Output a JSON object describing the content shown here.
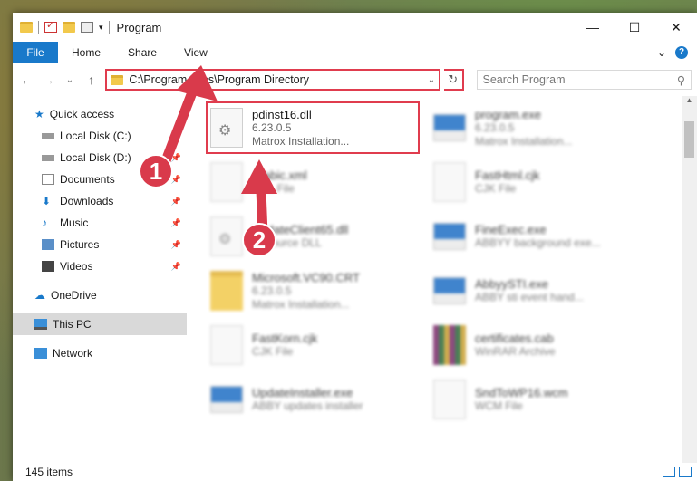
{
  "window": {
    "title": "Program",
    "minimize": "—",
    "maximize": "☐",
    "close": "✕"
  },
  "ribbon": {
    "file": "File",
    "home": "Home",
    "share": "Share",
    "view": "View",
    "expand": "⌄",
    "help": "?"
  },
  "nav": {
    "back": "←",
    "forward": "→",
    "recent": "⌄",
    "up": "↑",
    "refresh": "↻",
    "address": "C:\\Program Files\\Program Directory",
    "search_placeholder": "Search Program",
    "search_icon": "⚲"
  },
  "sidebar": {
    "quick_access": "Quick access",
    "items": [
      {
        "label": "Local Disk (C:)",
        "icon": "drive-icon"
      },
      {
        "label": "Local Disk (D:)",
        "icon": "drive-icon"
      },
      {
        "label": "Documents",
        "icon": "documents-icon"
      },
      {
        "label": "Downloads",
        "icon": "downloads-icon"
      },
      {
        "label": "Music",
        "icon": "music-icon"
      },
      {
        "label": "Pictures",
        "icon": "pictures-icon"
      },
      {
        "label": "Videos",
        "icon": "videos-icon"
      }
    ],
    "onedrive": "OneDrive",
    "this_pc": "This PC",
    "network": "Network"
  },
  "files": [
    {
      "name": "pdinst16.dll",
      "line2": "6.23.0.5",
      "line3": "Matrox Installation...",
      "type": "dll"
    },
    {
      "name": "program.exe",
      "line2": "6.23.0.5",
      "line3": "Matrox Installation...",
      "type": "exe"
    },
    {
      "name": "Arabic.xml",
      "line2": "XML File",
      "line3": "",
      "type": "doc"
    },
    {
      "name": "FastHtml.cjk",
      "line2": "CJK File",
      "line3": "",
      "type": "doc"
    },
    {
      "name": "UpdateClient65.dll",
      "line2": "Resource DLL",
      "line3": "",
      "type": "dll"
    },
    {
      "name": "FineExec.exe",
      "line2": "ABBYY background exe...",
      "line3": "",
      "type": "exe"
    },
    {
      "name": "Microsoft.VC90.CRT",
      "line2": "6.23.0.5",
      "line3": "Matrox Installation...",
      "type": "folder"
    },
    {
      "name": "AbbyySTI.exe",
      "line2": "ABBY sti event hand...",
      "line3": "",
      "type": "exe"
    },
    {
      "name": "FastKorn.cjk",
      "line2": "CJK File",
      "line3": "",
      "type": "doc"
    },
    {
      "name": "certificates.cab",
      "line2": "WinRAR Archive",
      "line3": "",
      "type": "cab"
    },
    {
      "name": "UpdateInstaller.exe",
      "line2": "ABBY updates installer",
      "line3": "",
      "type": "exe"
    },
    {
      "name": "SndToWP16.wcm",
      "line2": "WCM File",
      "line3": "",
      "type": "doc"
    }
  ],
  "status": {
    "count": "145 items"
  },
  "callouts": {
    "one": "1",
    "two": "2"
  },
  "colors": {
    "accent": "#1979ca",
    "highlight": "#e03c4e",
    "callout": "#d93a4b"
  }
}
